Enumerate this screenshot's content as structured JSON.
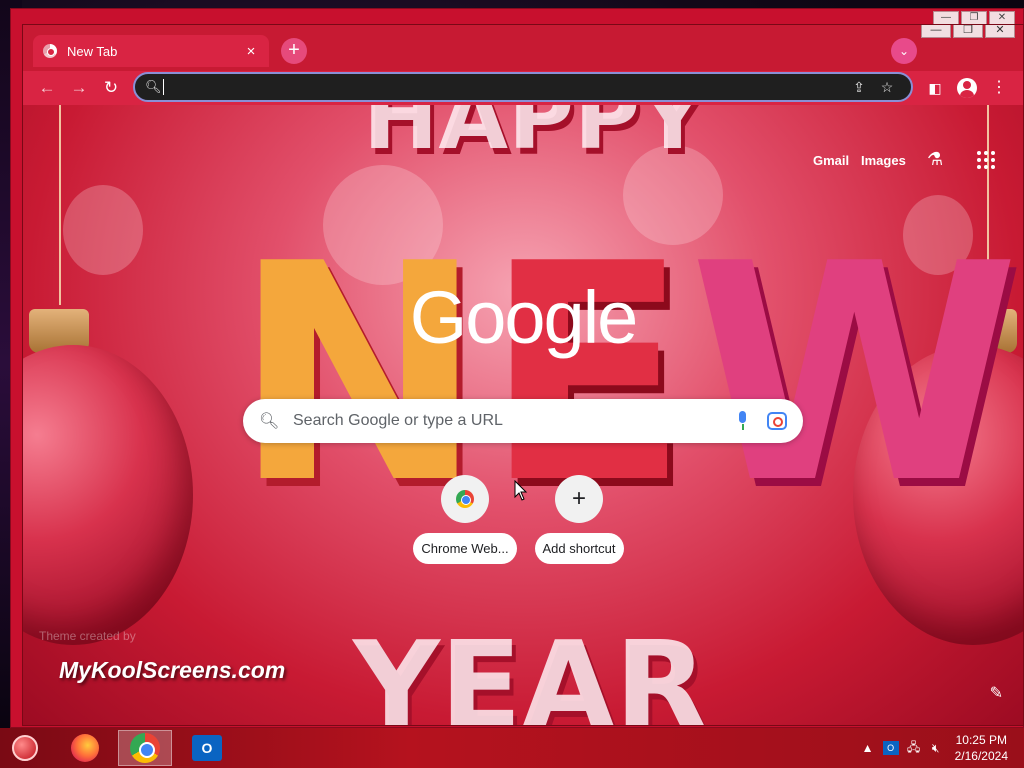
{
  "browser": {
    "tab_title": "New Tab",
    "tab_close": "×",
    "new_tab": "+",
    "tab_search": "⌄",
    "omnibox_value": "",
    "window_controls": [
      "—",
      "❐",
      "✕"
    ]
  },
  "ntp": {
    "links": {
      "gmail": "Gmail",
      "images": "Images"
    },
    "logo": "Google",
    "search_placeholder": "Search Google or type a URL",
    "shortcuts": [
      {
        "label": "Chrome Web...",
        "icon": "chrome-web-store-icon"
      },
      {
        "label": "Add shortcut",
        "icon": "plus-icon"
      }
    ],
    "theme_credit": "Theme created by",
    "brand": "MyKoolScreens.com",
    "background_text": {
      "top": "HAPPY",
      "middle": "NEW",
      "bottom": "YEAR"
    }
  },
  "taskbar": {
    "apps": [
      {
        "name": "ornament",
        "icon": "ornament-icon"
      },
      {
        "name": "Firefox",
        "icon": "firefox-icon"
      },
      {
        "name": "Chrome",
        "icon": "chrome-icon",
        "active": true
      },
      {
        "name": "Outlook",
        "icon": "outlook-icon"
      }
    ],
    "outlook_letter": "O",
    "tray_outlook_letter": "O",
    "time": "10:25 PM",
    "date": "2/16/2024"
  },
  "colors": {
    "frame": "#c41530",
    "tab_active": "#d92443",
    "omnibox_bg": "#1f1f1f",
    "omnibox_border": "#8a8fd6",
    "accent_pink": "#e64a7b"
  }
}
